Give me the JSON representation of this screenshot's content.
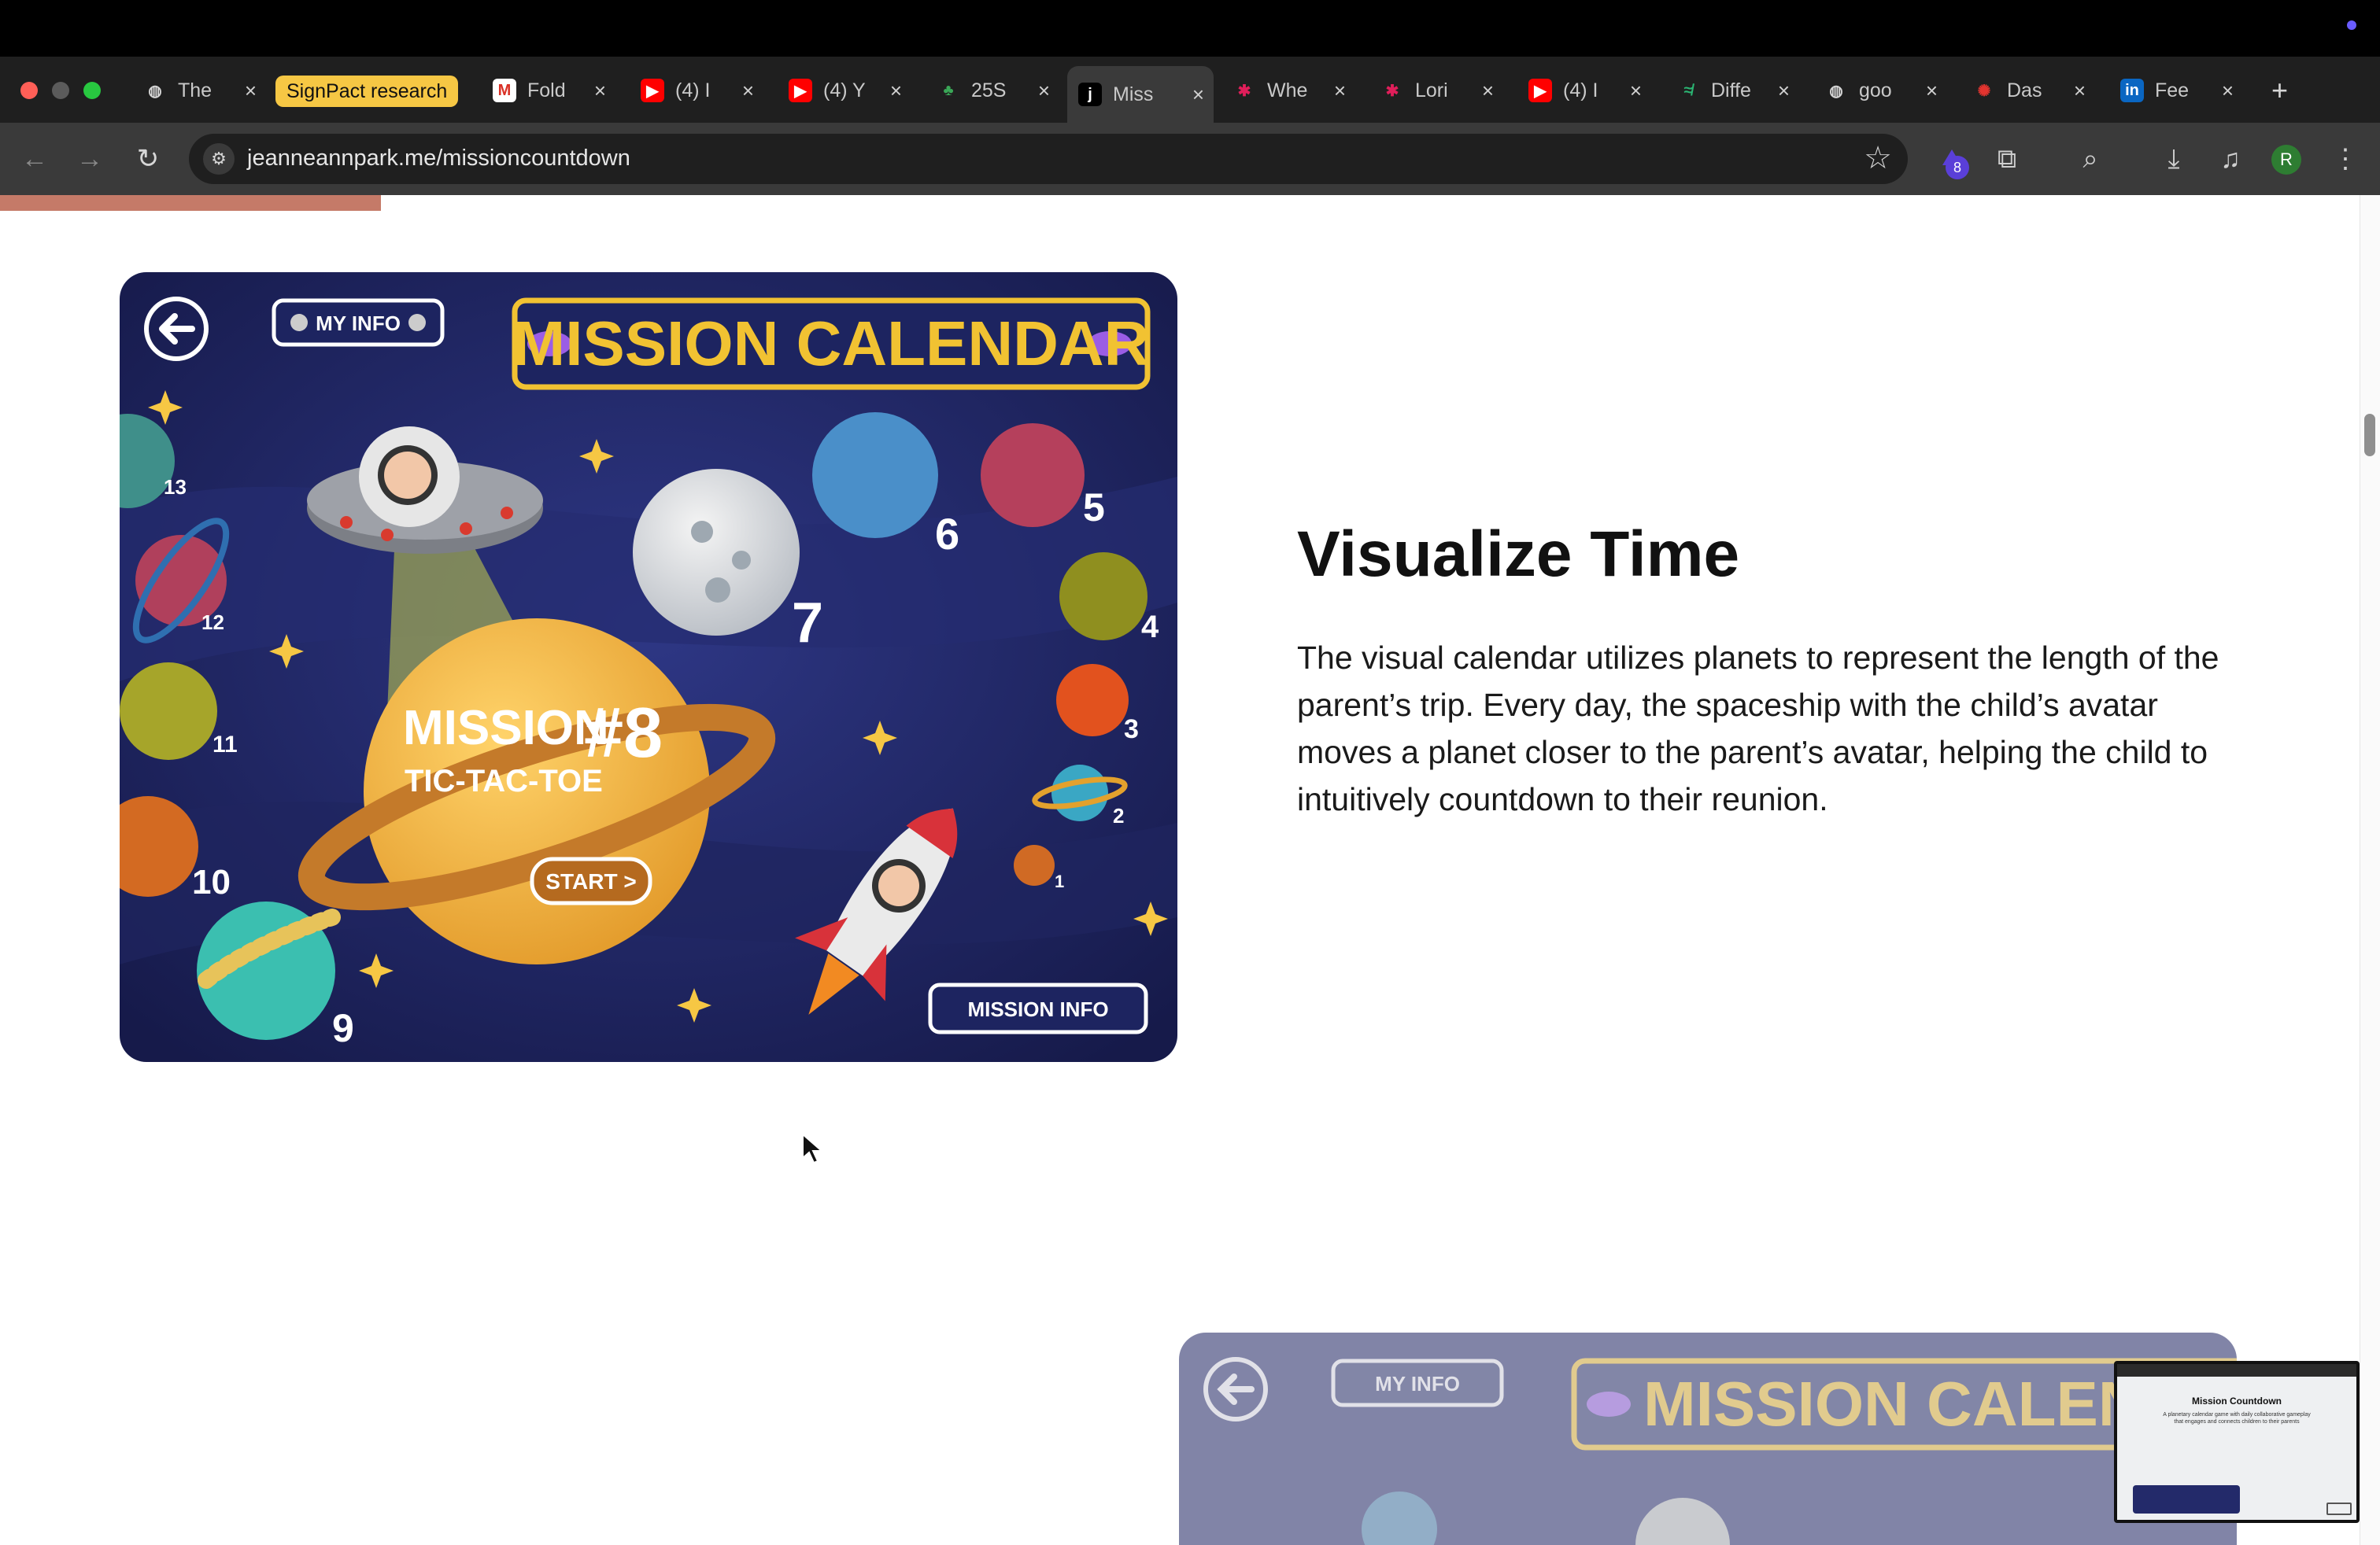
{
  "browser": {
    "tabs": [
      {
        "label": "The",
        "icon": "globe-icon"
      },
      {
        "label": "SignPact research",
        "icon": "none"
      },
      {
        "label": "Fold",
        "icon": "gmail-icon"
      },
      {
        "label": "(4) I",
        "icon": "youtube-icon"
      },
      {
        "label": "(4) Y",
        "icon": "youtube-icon"
      },
      {
        "label": "25S",
        "icon": "leaf-icon"
      },
      {
        "label": "Miss",
        "icon": "site-j-icon"
      },
      {
        "label": "Whe",
        "icon": "slack-icon"
      },
      {
        "label": "Lori",
        "icon": "slack-icon"
      },
      {
        "label": "(4) I",
        "icon": "youtube-icon"
      },
      {
        "label": "Diffe",
        "icon": "diff-icon"
      },
      {
        "label": "goo",
        "icon": "globe-icon"
      },
      {
        "label": "Das",
        "icon": "dashboard-icon"
      },
      {
        "label": "Fee",
        "icon": "linkedin-icon"
      }
    ],
    "active_tab_index": 6,
    "new_tab": "+",
    "url": "jeanneannpark.me/missioncountdown",
    "extension_badge": "8",
    "profile_initial": "R",
    "colors": {
      "chrome_dark": "#1f1f1f",
      "toolbar": "#3a3a3a",
      "pill": "#f6c744"
    }
  },
  "page": {
    "reading_progress": 0.16,
    "game": {
      "title": "MISSION CALENDAR",
      "my_info": "MY INFO",
      "mission_label": "MISSION",
      "mission_number": "#8",
      "mission_name": "TIC-TAC-TOE",
      "start": "START >",
      "mission_info": "MISSION INFO",
      "planet_numbers": [
        "13",
        "12",
        "11",
        "10",
        "9",
        "7",
        "6",
        "5",
        "4",
        "3",
        "2",
        "1"
      ]
    },
    "section": {
      "heading": "Visualize Time",
      "body": "The visual calendar utilizes planets to represent the length of the parent’s trip. Every day, the spaceship with the child’s avatar moves a planet closer to the parent’s avatar, helping the child to intuitively countdown to their reunion."
    },
    "preview_game": {
      "title": "MISSION CALENDA",
      "my_info": "MY INFO"
    },
    "mini_preview": {
      "title": "Mission Countdown",
      "subtitle": "A planetary calendar game with daily collaborative gameplay that engages and connects children to their parents"
    }
  }
}
